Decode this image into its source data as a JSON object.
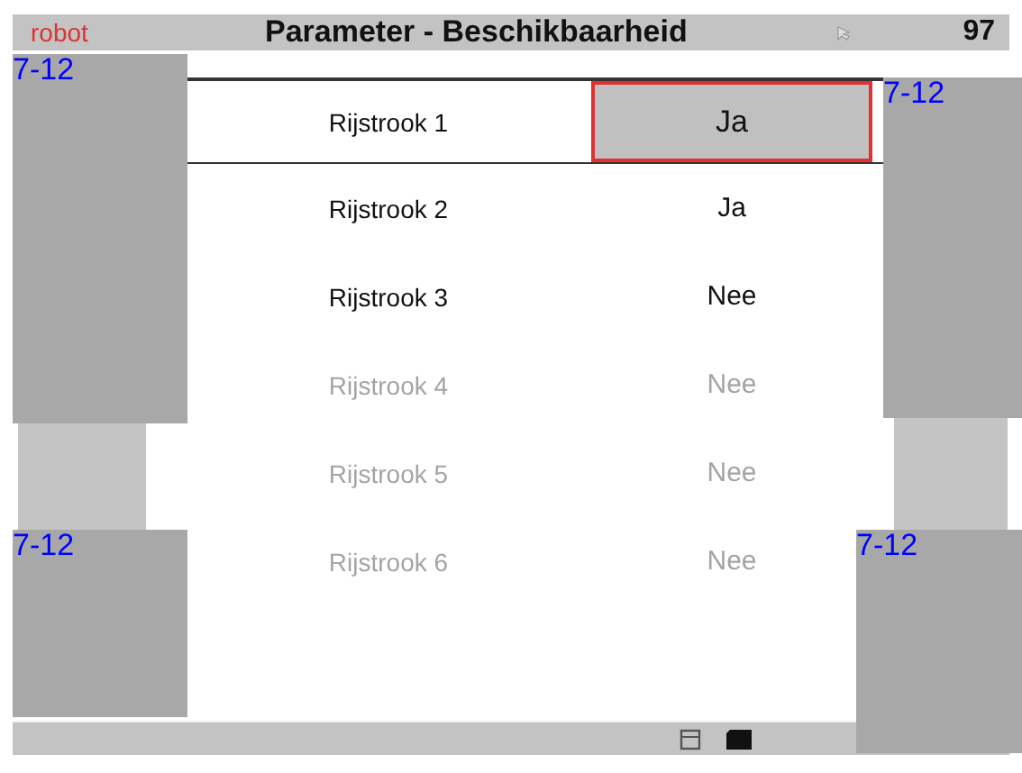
{
  "header": {
    "logo": "robot",
    "title": "Parameter - Beschikbaarheid",
    "number": "97"
  },
  "rows": [
    {
      "label": "Rijstrook 1",
      "value": "Ja",
      "selected": true,
      "disabled": false
    },
    {
      "label": "Rijstrook 2",
      "value": "Ja",
      "selected": false,
      "disabled": false
    },
    {
      "label": "Rijstrook 3",
      "value": "Nee",
      "selected": false,
      "disabled": false
    },
    {
      "label": "Rijstrook 4",
      "value": "Nee",
      "selected": false,
      "disabled": true
    },
    {
      "label": "Rijstrook 5",
      "value": "Nee",
      "selected": false,
      "disabled": true
    },
    {
      "label": "Rijstrook 6",
      "value": "Nee",
      "selected": false,
      "disabled": true
    }
  ],
  "overlays": [
    {
      "kind": "panel",
      "label": "7-12"
    },
    {
      "kind": "key"
    },
    {
      "kind": "panel",
      "label": "7-12"
    },
    {
      "kind": "panel",
      "label": "7-12"
    },
    {
      "kind": "key"
    },
    {
      "kind": "panel",
      "label": "7-12"
    }
  ]
}
